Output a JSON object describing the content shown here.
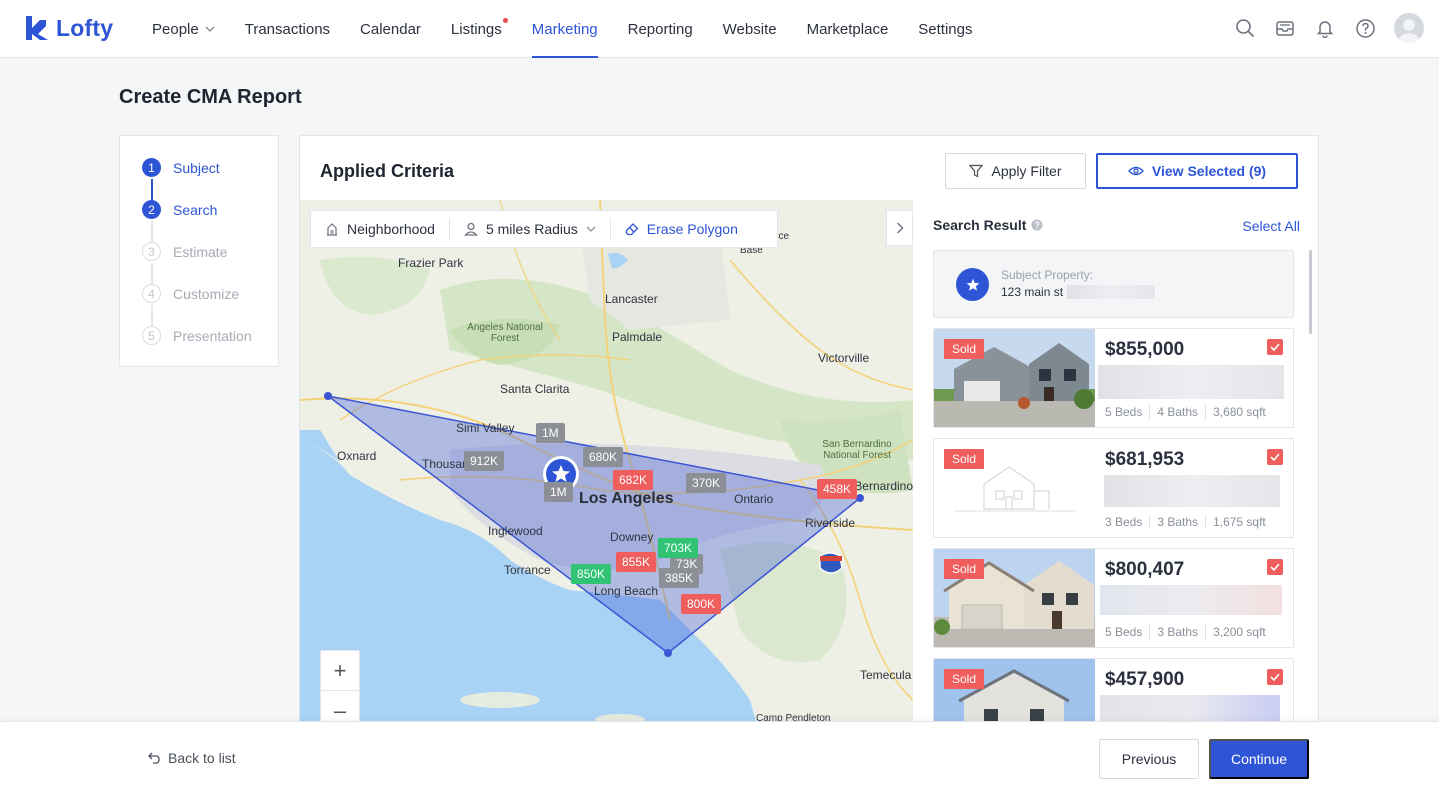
{
  "brand": {
    "name": "Lofty",
    "color": "#2d55d6"
  },
  "nav": {
    "items": [
      {
        "label": "People",
        "has_caret": true
      },
      {
        "label": "Transactions"
      },
      {
        "label": "Calendar"
      },
      {
        "label": "Listings",
        "has_dot": true
      },
      {
        "label": "Marketing",
        "active": true
      },
      {
        "label": "Reporting"
      },
      {
        "label": "Website"
      },
      {
        "label": "Marketplace"
      },
      {
        "label": "Settings"
      }
    ],
    "icons": [
      "search-icon",
      "inbox-icon",
      "bell-icon",
      "help-icon",
      "user-avatar"
    ]
  },
  "page": {
    "title": "Create CMA Report"
  },
  "steps": [
    {
      "num": "1",
      "label": "Subject",
      "state": "done"
    },
    {
      "num": "2",
      "label": "Search",
      "state": "done"
    },
    {
      "num": "3",
      "label": "Estimate",
      "state": "todo"
    },
    {
      "num": "4",
      "label": "Customize",
      "state": "todo"
    },
    {
      "num": "5",
      "label": "Presentation",
      "state": "todo"
    }
  ],
  "panel": {
    "title": "Applied Criteria",
    "apply_filter": "Apply Filter",
    "view_selected": "View Selected (9)"
  },
  "map": {
    "toolbar": {
      "neighborhood": "Neighborhood",
      "radius": "5 miles Radius",
      "erase": "Erase Polygon"
    },
    "zoom_in": "+",
    "zoom_out": "–",
    "cities": [
      {
        "name": "Frazier Park"
      },
      {
        "name": "Lancaster"
      },
      {
        "name": "Palmdale"
      },
      {
        "name": "Angeles National Forest"
      },
      {
        "name": "Victorville"
      },
      {
        "name": "Santa Clarita"
      },
      {
        "name": "Simi Valley"
      },
      {
        "name": "Oxnard"
      },
      {
        "name": "Thousand Oaks"
      },
      {
        "name": "Los Angeles"
      },
      {
        "name": "Ontario"
      },
      {
        "name": "San Bernardino National Forest"
      },
      {
        "name": "San Bernardino"
      },
      {
        "name": "Riverside"
      },
      {
        "name": "Inglewood"
      },
      {
        "name": "Downey"
      },
      {
        "name": "Torrance"
      },
      {
        "name": "Long Beach"
      },
      {
        "name": "Temecula"
      },
      {
        "name": "Camp Pendleton"
      },
      {
        "name": "Base"
      },
      {
        "name": "Force"
      }
    ],
    "price_tags": [
      {
        "label": "1M",
        "color": "gray"
      },
      {
        "label": "912K",
        "color": "gray"
      },
      {
        "label": "680K",
        "color": "gray"
      },
      {
        "label": "682K",
        "color": "red"
      },
      {
        "label": "1M",
        "color": "gray"
      },
      {
        "label": "370K",
        "color": "gray"
      },
      {
        "label": "458K",
        "color": "red"
      },
      {
        "label": "703K",
        "color": "green"
      },
      {
        "label": "73K",
        "color": "gray"
      },
      {
        "label": "855K",
        "color": "red"
      },
      {
        "label": "850K",
        "color": "green"
      },
      {
        "label": "385K",
        "color": "gray"
      },
      {
        "label": "800K",
        "color": "red"
      }
    ],
    "highway_shield": "15"
  },
  "results": {
    "title": "Search Result",
    "select_all": "Select All",
    "subject": {
      "label": "Subject Property:",
      "address": "123 main st"
    },
    "properties": [
      {
        "status": "Sold",
        "price": "$855,000",
        "beds": "5 Beds",
        "baths": "4 Baths",
        "sqft": "3,680 sqft",
        "checked": true,
        "image": "house-photo"
      },
      {
        "status": "Sold",
        "price": "$681,953",
        "beds": "3 Beds",
        "baths": "3 Baths",
        "sqft": "1,675 sqft",
        "checked": true,
        "image": "house-placeholder"
      },
      {
        "status": "Sold",
        "price": "$800,407",
        "beds": "5 Beds",
        "baths": "3 Baths",
        "sqft": "3,200 sqft",
        "checked": true,
        "image": "house-photo"
      },
      {
        "status": "Sold",
        "price": "$457,900",
        "beds": "",
        "baths": "",
        "sqft": "",
        "checked": true,
        "image": "house-photo"
      }
    ]
  },
  "footer": {
    "back": "Back to list",
    "previous": "Previous",
    "continue": "Continue"
  }
}
